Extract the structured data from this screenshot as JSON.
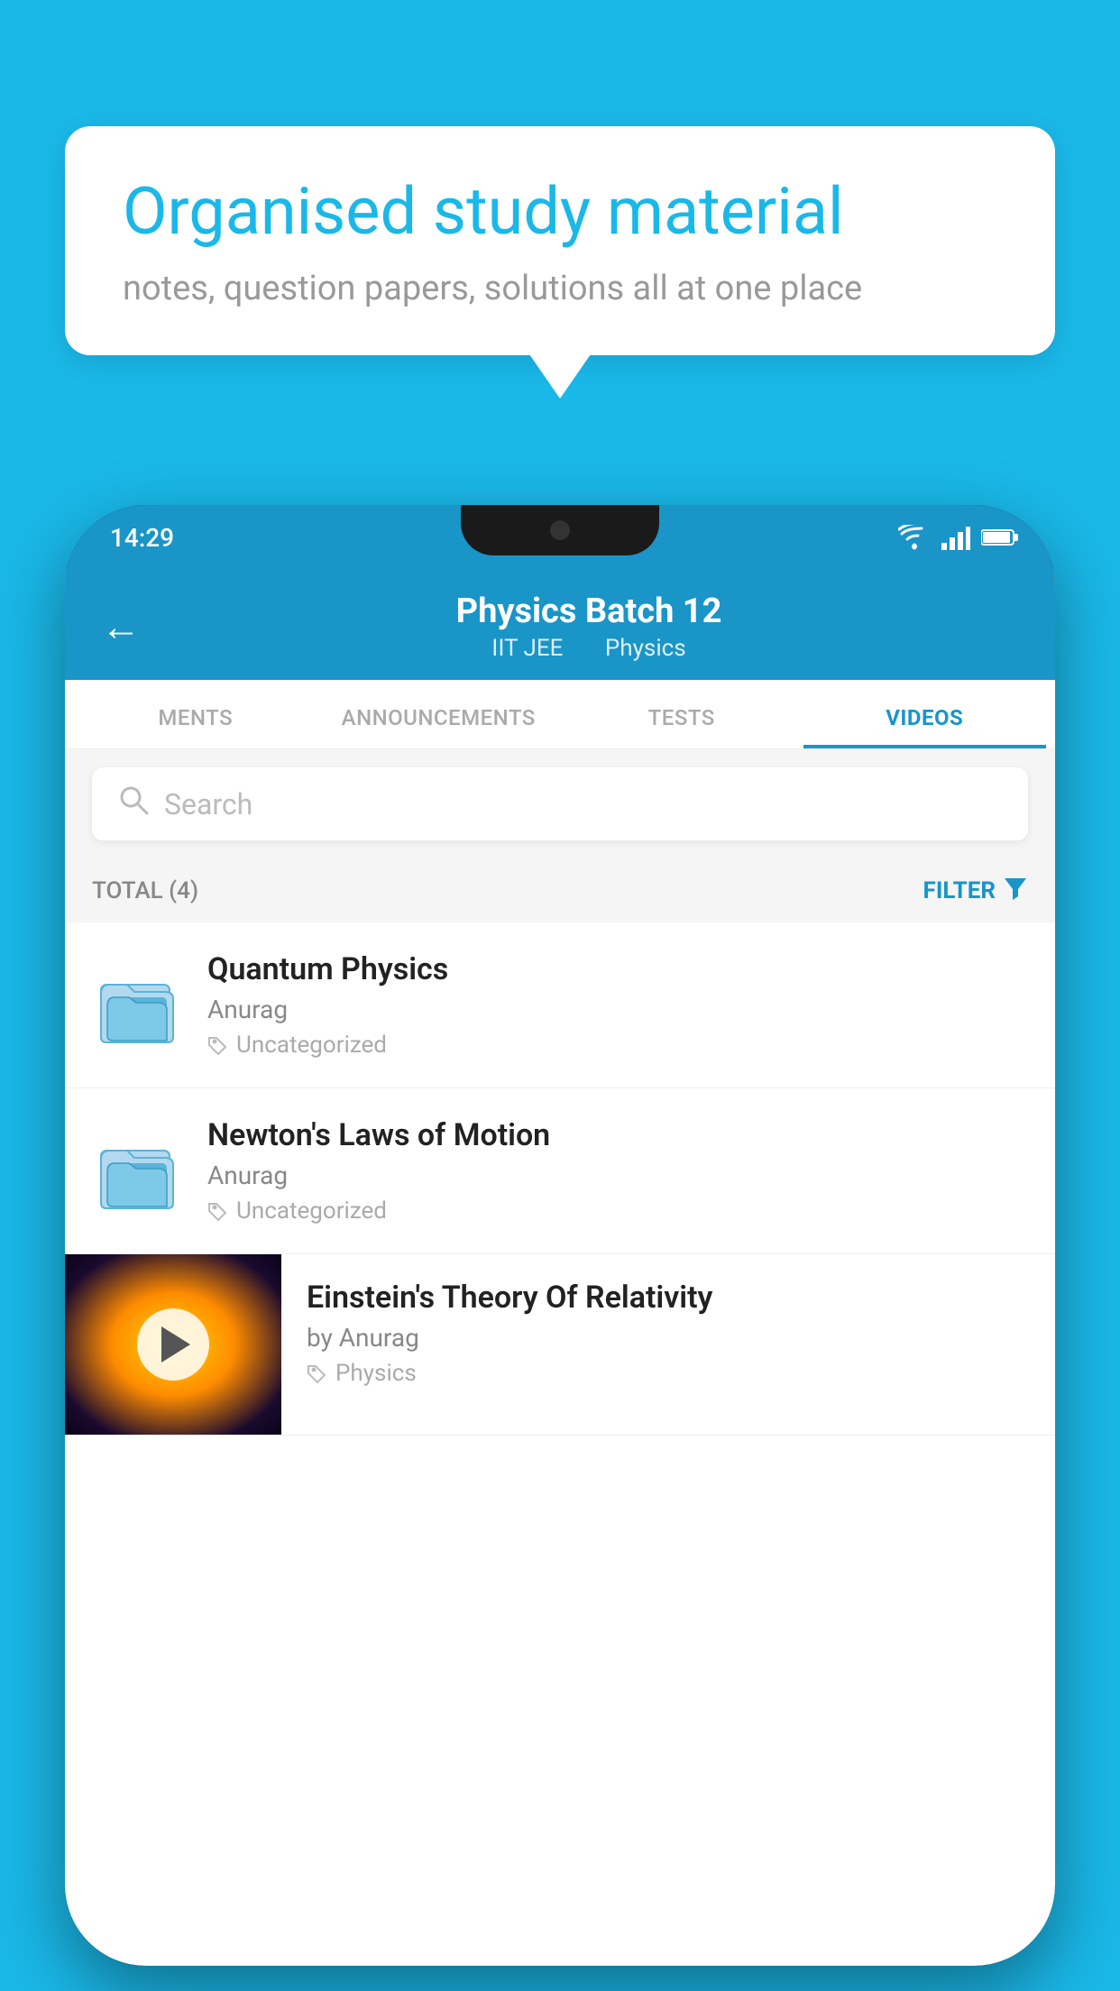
{
  "background_color": "#1ab8e8",
  "bubble": {
    "title": "Organised study material",
    "subtitle": "notes, question papers, solutions all at one place"
  },
  "status_bar": {
    "time": "14:29",
    "icons": [
      "wifi",
      "signal",
      "battery"
    ]
  },
  "header": {
    "title": "Physics Batch 12",
    "subtitle1": "IIT JEE",
    "subtitle2": "Physics",
    "back_label": "←"
  },
  "tabs": [
    {
      "label": "MENTS",
      "active": false
    },
    {
      "label": "ANNOUNCEMENTS",
      "active": false
    },
    {
      "label": "TESTS",
      "active": false
    },
    {
      "label": "VIDEOS",
      "active": true
    }
  ],
  "search": {
    "placeholder": "Search"
  },
  "filter": {
    "total_label": "TOTAL (4)",
    "filter_label": "FILTER"
  },
  "videos": [
    {
      "title": "Quantum Physics",
      "author": "Anurag",
      "tag": "Uncategorized",
      "type": "folder"
    },
    {
      "title": "Newton's Laws of Motion",
      "author": "Anurag",
      "tag": "Uncategorized",
      "type": "folder"
    },
    {
      "title": "Einstein's Theory Of Relativity",
      "author": "by Anurag",
      "tag": "Physics",
      "type": "video"
    }
  ],
  "icons": {
    "search": "🔍",
    "tag": "🏷",
    "filter_funnel": "▼",
    "folder": "📁"
  }
}
